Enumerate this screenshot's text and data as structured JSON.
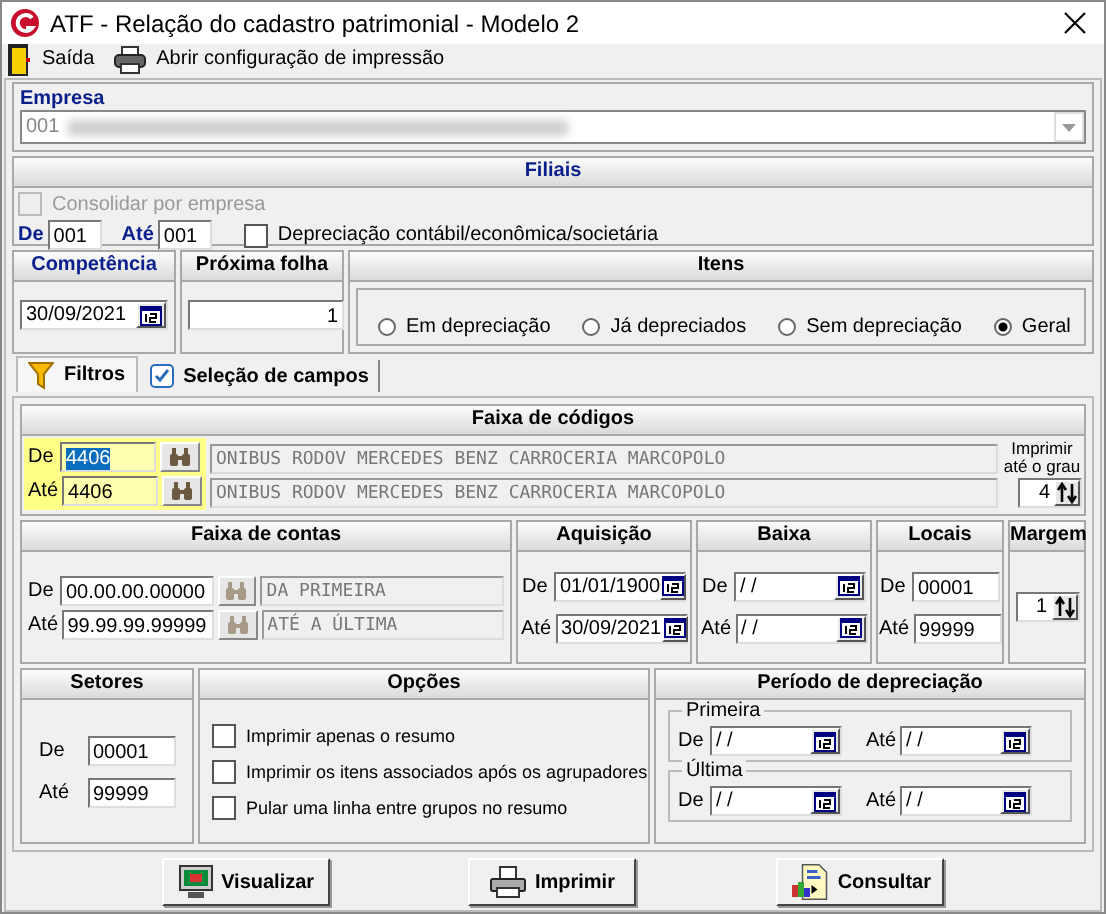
{
  "window": {
    "title": "ATF - Relação do cadastro patrimonial - Modelo 2"
  },
  "menu": [
    {
      "label": "Saída",
      "kind": "exit"
    },
    {
      "label": "Abrir configuração de impressão",
      "kind": "print"
    }
  ],
  "empresa": {
    "title": "Empresa",
    "value": "001"
  },
  "filiais": {
    "title": "Filiais",
    "consolidar": {
      "label": "Consolidar por empresa",
      "checked": false,
      "disabled": true
    },
    "de_label": "De",
    "de": "001",
    "ate_label": "Até",
    "ate": "001",
    "depreciacao": {
      "label": "Depreciação contábil/econômica/societária",
      "checked": false
    }
  },
  "competencia": {
    "title": "Competência",
    "value": "30/09/2021"
  },
  "proxima_folha": {
    "title": "Próxima folha",
    "value": "1"
  },
  "itens": {
    "title": "Itens",
    "options": [
      {
        "label": "Em depreciação",
        "selected": false
      },
      {
        "label": "Já depreciados",
        "selected": false
      },
      {
        "label": "Sem depreciação",
        "selected": false
      },
      {
        "label": "Geral",
        "selected": true
      }
    ]
  },
  "tabs": [
    {
      "label": "Filtros",
      "kind": "filter",
      "selected": true
    },
    {
      "label": "Seleção de campos",
      "kind": "checkbox",
      "selected": false
    }
  ],
  "faixa_codigos": {
    "title": "Faixa de códigos",
    "rows": [
      {
        "label": "De",
        "code": "4406",
        "highlighted": true,
        "description": "ONIBUS RODOV MERCEDES BENZ CARROCERIA MARCOPOLO"
      },
      {
        "label": "Até",
        "code": "4406",
        "highlighted": false,
        "description": "ONIBUS RODOV MERCEDES BENZ CARROCERIA MARCOPOLO"
      }
    ],
    "grau_label": "Imprimir até o grau",
    "grau": "4"
  },
  "faixa_contas": {
    "title": "Faixa de contas",
    "rows": [
      {
        "label": "De",
        "value": "00.00.00.00000",
        "description": "DA PRIMEIRA"
      },
      {
        "label": "Até",
        "value": "99.99.99.99999",
        "description": "ATÉ A ÚLTIMA"
      }
    ]
  },
  "aquisicao": {
    "title": "Aquisição",
    "rows": [
      {
        "label": "De",
        "value": "01/01/1900"
      },
      {
        "label": "Até",
        "value": "30/09/2021"
      }
    ]
  },
  "baixa": {
    "title": "Baixa",
    "rows": [
      {
        "label": "De",
        "value": "/ /"
      },
      {
        "label": "Até",
        "value": "/ /"
      }
    ]
  },
  "locais": {
    "title": "Locais",
    "rows": [
      {
        "label": "De",
        "value": "00001"
      },
      {
        "label": "Até",
        "value": "99999"
      }
    ]
  },
  "margem": {
    "title": "Margem",
    "value": "1"
  },
  "setores": {
    "title": "Setores",
    "rows": [
      {
        "label": "De",
        "value": "00001"
      },
      {
        "label": "Até",
        "value": "99999"
      }
    ]
  },
  "opcoes": {
    "title": "Opções",
    "options": [
      {
        "label": "Imprimir apenas o resumo",
        "checked": false
      },
      {
        "label": "Imprimir os itens associados após os agrupadores",
        "checked": false
      },
      {
        "label": "Pular uma linha entre grupos no resumo",
        "checked": false
      }
    ]
  },
  "periodo": {
    "title": "Período de depreciação",
    "groups": [
      {
        "title": "Primeira",
        "de_label": "De",
        "de": "/ /",
        "ate_label": "Até",
        "ate": "/ /"
      },
      {
        "title": "Última",
        "de_label": "De",
        "de": "/ /",
        "ate_label": "Até",
        "ate": "/ /"
      }
    ]
  },
  "buttons": [
    {
      "label": "Visualizar",
      "kind": "view"
    },
    {
      "label": "Imprimir",
      "kind": "print"
    },
    {
      "label": "Consultar",
      "kind": "query"
    }
  ]
}
